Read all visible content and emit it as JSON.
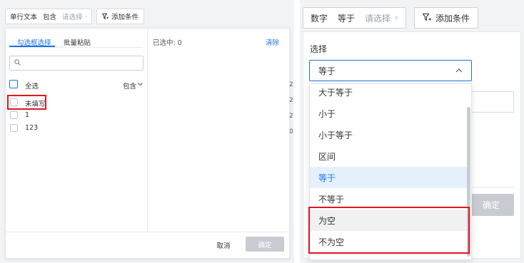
{
  "left": {
    "condition": {
      "field": "单行文本",
      "operator": "包含",
      "placeholder": "请选择"
    },
    "add_condition": "添加条件",
    "tabs": [
      {
        "label": "勾选框选择"
      },
      {
        "label": "批量粘贴"
      }
    ],
    "selected_count": "已选中: 0",
    "clear": "清除",
    "select_all": "全选",
    "match_mode": "包含",
    "items": [
      {
        "label": "未填写"
      },
      {
        "label": "1"
      },
      {
        "label": "123"
      }
    ],
    "cancel": "取消",
    "confirm": "确定"
  },
  "right": {
    "condition": {
      "field": "数字",
      "operator": "等于",
      "placeholder": "请选择"
    },
    "add_condition": "添加条件",
    "section_title": "选择",
    "selected_value": "等于",
    "confirm": "确定",
    "options": [
      {
        "label": "大于等于"
      },
      {
        "label": "小于"
      },
      {
        "label": "小于等于"
      },
      {
        "label": "区间"
      },
      {
        "label": "等于"
      },
      {
        "label": "不等于"
      },
      {
        "label": "为空"
      },
      {
        "label": "不为空"
      }
    ]
  },
  "colors": {
    "accent": "#1a73e8",
    "highlight_border": "#e0161f"
  }
}
